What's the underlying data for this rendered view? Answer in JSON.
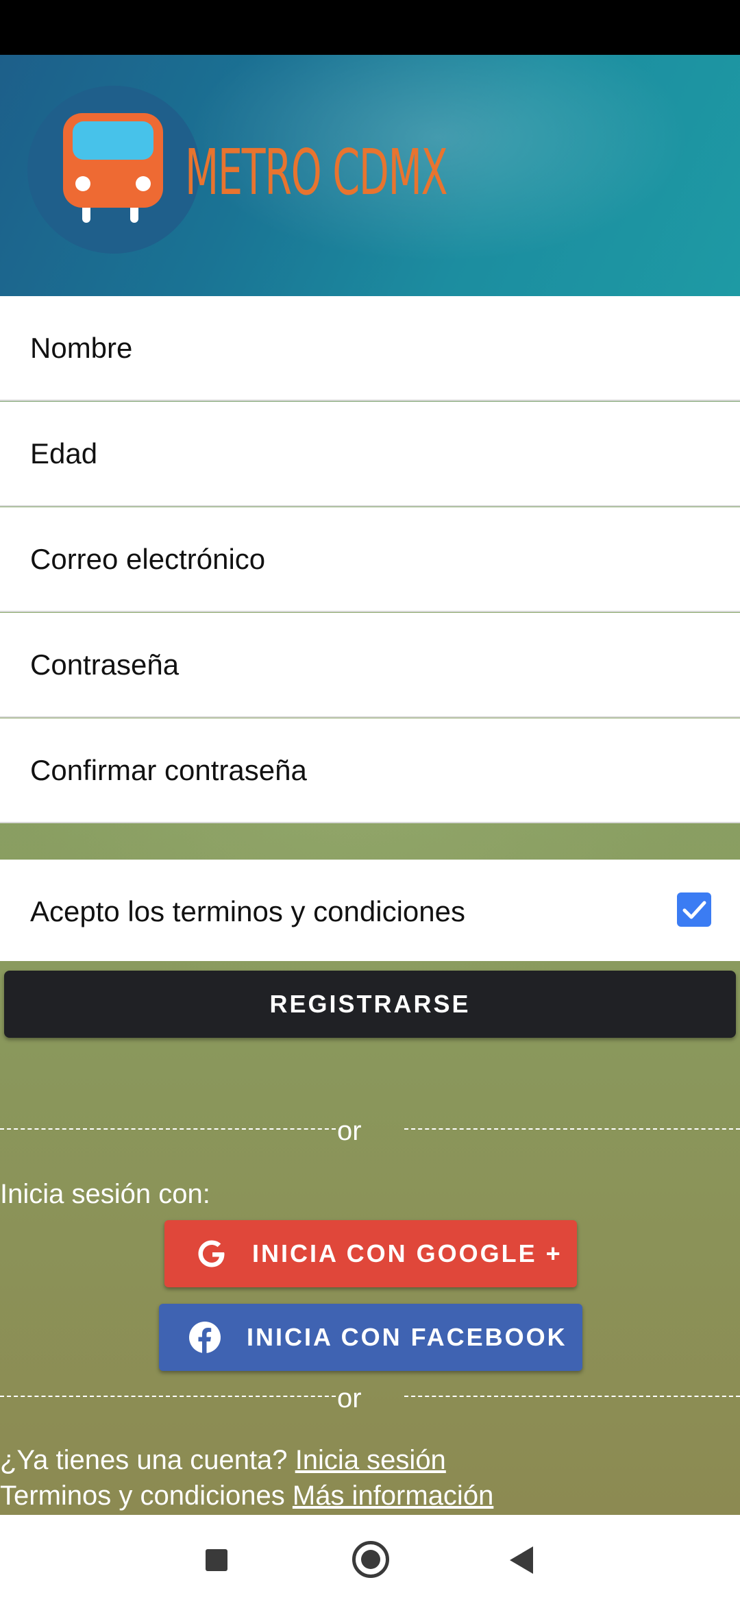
{
  "app": {
    "brand_name": "METRO CDMX",
    "brand_color": "#e8742f",
    "logo_icon": "bus-icon"
  },
  "form": {
    "fields": [
      {
        "placeholder": "Nombre",
        "value": ""
      },
      {
        "placeholder": "Edad",
        "value": ""
      },
      {
        "placeholder": "Correo electrónico",
        "value": ""
      },
      {
        "placeholder": "Contraseña",
        "value": ""
      },
      {
        "placeholder": "Confirmar contraseña",
        "value": ""
      }
    ],
    "terms_label": "Acepto los terminos y condiciones",
    "terms_checked": true,
    "checkbox_color": "#3b7cf3",
    "register_label": "REGISTRARSE"
  },
  "divider_text": "or",
  "login": {
    "label": "Inicia sesión con:",
    "google_label": "INICIA CON GOOGLE +",
    "google_icon": "google-icon",
    "google_color": "#e0473a",
    "facebook_label": "INICIA CON FACEBOOK",
    "facebook_icon": "facebook-icon",
    "facebook_color": "#3f63b2"
  },
  "footer": {
    "account_text": "¿Ya tienes una cuenta?",
    "account_link": "Inicia sesión",
    "terms_text": "Terminos y condiciones",
    "terms_link": "Más información"
  },
  "navigation": {
    "recents_icon": "square-icon",
    "home_icon": "circle-icon",
    "back_icon": "triangle-back-icon"
  }
}
